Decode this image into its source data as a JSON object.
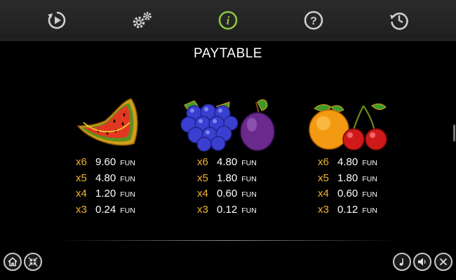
{
  "header": {
    "tabs": [
      {
        "name": "autoplay",
        "icon": "replay-icon",
        "active": false
      },
      {
        "name": "settings",
        "icon": "gears-icon",
        "active": false
      },
      {
        "name": "info",
        "icon": "info-icon",
        "active": true
      },
      {
        "name": "help",
        "icon": "question-icon",
        "active": false
      },
      {
        "name": "history",
        "icon": "history-icon",
        "active": false
      }
    ],
    "active_color": "#8dc63f",
    "icon_color": "#cfcfcf"
  },
  "title": "PAYTABLE",
  "symbols": [
    {
      "name": "watermelon",
      "icon": "watermelon-icon",
      "payouts": [
        {
          "mult": "x6",
          "amount": "9.60",
          "unit": "FUN"
        },
        {
          "mult": "x5",
          "amount": "4.80",
          "unit": "FUN"
        },
        {
          "mult": "x4",
          "amount": "1.20",
          "unit": "FUN"
        },
        {
          "mult": "x3",
          "amount": "0.24",
          "unit": "FUN"
        }
      ]
    },
    {
      "name": "grapes-plum",
      "icon": "grapes-plum-icon",
      "payouts": [
        {
          "mult": "x6",
          "amount": "4.80",
          "unit": "FUN"
        },
        {
          "mult": "x5",
          "amount": "1.80",
          "unit": "FUN"
        },
        {
          "mult": "x4",
          "amount": "0.60",
          "unit": "FUN"
        },
        {
          "mult": "x3",
          "amount": "0.12",
          "unit": "FUN"
        }
      ]
    },
    {
      "name": "orange-cherries",
      "icon": "orange-cherries-icon",
      "payouts": [
        {
          "mult": "x6",
          "amount": "4.80",
          "unit": "FUN"
        },
        {
          "mult": "x5",
          "amount": "1.80",
          "unit": "FUN"
        },
        {
          "mult": "x4",
          "amount": "0.60",
          "unit": "FUN"
        },
        {
          "mult": "x3",
          "amount": "0.12",
          "unit": "FUN"
        }
      ]
    }
  ],
  "colors": {
    "multiplier": "#f2b531",
    "amount": "#ffffff"
  },
  "footer": {
    "left_buttons": [
      {
        "icon": "home-icon"
      },
      {
        "icon": "collapse-icon"
      }
    ],
    "right_buttons": [
      {
        "icon": "music-icon"
      },
      {
        "icon": "sound-icon"
      },
      {
        "icon": "close-icon"
      }
    ]
  }
}
